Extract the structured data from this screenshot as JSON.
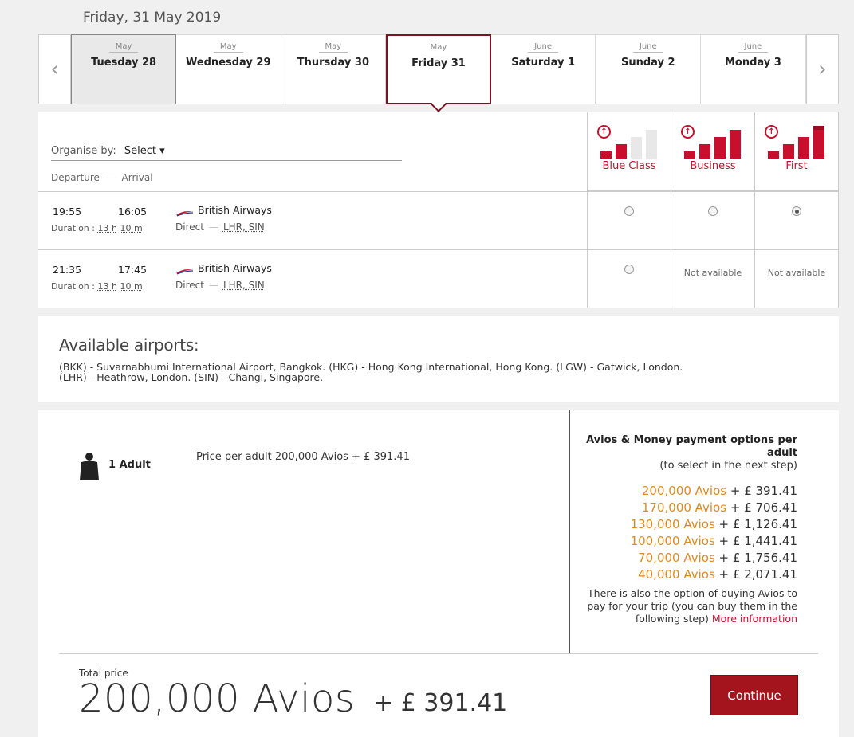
{
  "header": {
    "date": "Friday, 31 May 2019"
  },
  "dates": [
    {
      "month": "May",
      "day": "Tuesday 28",
      "state": "past"
    },
    {
      "month": "May",
      "day": "Wednesday 29",
      "state": "normal"
    },
    {
      "month": "May",
      "day": "Thursday 30",
      "state": "normal"
    },
    {
      "month": "May",
      "day": "Friday 31",
      "state": "selected"
    },
    {
      "month": "June",
      "day": "Saturday 1",
      "state": "normal"
    },
    {
      "month": "June",
      "day": "Sunday 2",
      "state": "normal"
    },
    {
      "month": "June",
      "day": "Monday 3",
      "state": "normal"
    }
  ],
  "nav": {
    "prev": "‹",
    "next": "›"
  },
  "filters": {
    "organise_label": "Organise by:",
    "organise_value": "Select ▾",
    "departure": "Departure",
    "sep": "—",
    "arrival": "Arrival"
  },
  "cabins": [
    {
      "name": "Blue Class",
      "bars": [
        1,
        2,
        3,
        4
      ],
      "filled": 2
    },
    {
      "name": "Business",
      "bars": [
        1,
        2,
        3,
        4
      ],
      "filled": 4
    },
    {
      "name": "First",
      "bars": [
        1,
        2,
        3,
        4
      ],
      "filled": 4
    }
  ],
  "flights": [
    {
      "dep": "19:55",
      "arr": "16:05",
      "duration_label": "Duration : ",
      "dur_h": "13 h",
      "dur_m": "10 m",
      "airline": "British Airways",
      "direct": "Direct",
      "dash": "—",
      "route": "LHR, SIN",
      "cabin_status": [
        "radio",
        "radio",
        "radio-selected"
      ]
    },
    {
      "dep": "21:35",
      "arr": "17:45",
      "duration_label": "Duration : ",
      "dur_h": "13 h",
      "dur_m": "10 m",
      "airline": "British Airways",
      "direct": "Direct",
      "dash": "—",
      "route": "LHR, SIN",
      "cabin_status": [
        "radio",
        "Not available",
        "Not available"
      ]
    }
  ],
  "airports": {
    "title": "Available airports:",
    "line1": "(BKK) - Suvarnabhumi International Airport, Bangkok. (HKG) - Hong Kong International, Hong Kong. (LGW) - Gatwick, London.",
    "line2": "(LHR) - Heathrow, London. (SIN) - Changi, Singapore."
  },
  "pricing": {
    "adult_label": "1 Adult",
    "price_per_adult": "Price per adult 200,000 Avios + £ 391.41",
    "options_title": "Avios & Money payment options per adult",
    "options_sub": "(to select in the next step)",
    "options": [
      {
        "avios": "200,000 Avios",
        "money": " + £ 391.41"
      },
      {
        "avios": "170,000 Avios",
        "money": " + £ 706.41"
      },
      {
        "avios": "130,000 Avios",
        "money": " + £ 1,126.41"
      },
      {
        "avios": "100,000 Avios",
        "money": " + £ 1,441.41"
      },
      {
        "avios": "70,000 Avios",
        "money": " + £ 1,756.41"
      },
      {
        "avios": "40,000 Avios",
        "money": " + £ 2,071.41"
      }
    ],
    "buy_text": "There is also the option of buying Avios to pay for your trip (you can buy them in the following step)",
    "more_info": "More information",
    "total_label": "Total price",
    "total_avios": "200,000 Avios",
    "total_money": "+ £ 391.41",
    "continue": "Continue"
  },
  "colors": {
    "brand_red": "#c8102e",
    "selected_border": "#7a1422",
    "avios_orange": "#e08a1e",
    "continue_bg": "#a3141d"
  },
  "icons": {
    "cabin": "upgrade-arrow-icon",
    "airline": "british-airways-speedmarque-icon",
    "adult": "person-icon"
  }
}
